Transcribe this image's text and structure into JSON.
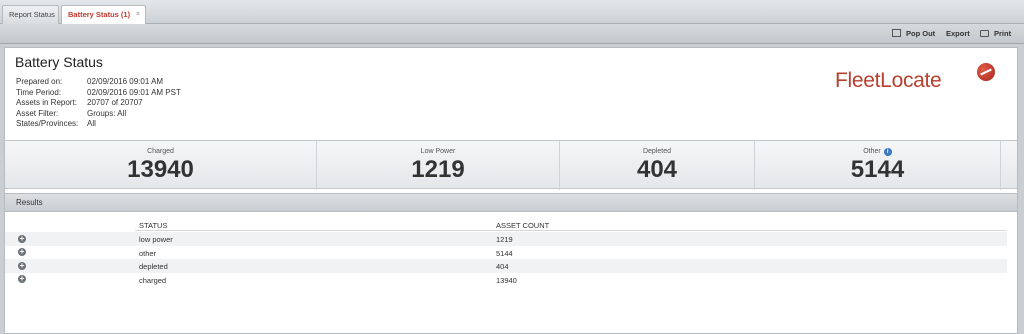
{
  "tabs": [
    {
      "label": "Report Status"
    },
    {
      "label": "Battery Status (1)",
      "close": "×"
    }
  ],
  "toolbar": {
    "popout_label": "Pop Out",
    "export_label": "Export",
    "print_label": "Print"
  },
  "report": {
    "title": "Battery Status",
    "meta": [
      {
        "key": "Prepared on:",
        "value": "02/09/2016 09:01 AM"
      },
      {
        "key": "Time Period:",
        "value": "02/09/2016 09:01 AM PST"
      },
      {
        "key": "Assets in Report:",
        "value": "20707 of 20707"
      },
      {
        "key": "Asset Filter:",
        "value": "Groups: All"
      },
      {
        "key": "States/Provinces:",
        "value": "All"
      }
    ]
  },
  "logo": {
    "text": "FleetLocate",
    "color": "#b8402e"
  },
  "stats": [
    {
      "label": "Charged",
      "value": "13940"
    },
    {
      "label": "Low Power",
      "value": "1219"
    },
    {
      "label": "Depleted",
      "value": "404"
    },
    {
      "label": "Other",
      "value": "5144",
      "info_icon": "i"
    }
  ],
  "results": {
    "header": "Results",
    "columns": [
      "STATUS",
      "ASSET COUNT"
    ],
    "rows": [
      {
        "status": "low power",
        "count": "1219"
      },
      {
        "status": "other",
        "count": "5144"
      },
      {
        "status": "depleted",
        "count": "404"
      },
      {
        "status": "charged",
        "count": "13940"
      }
    ],
    "expand_glyph": "+"
  }
}
